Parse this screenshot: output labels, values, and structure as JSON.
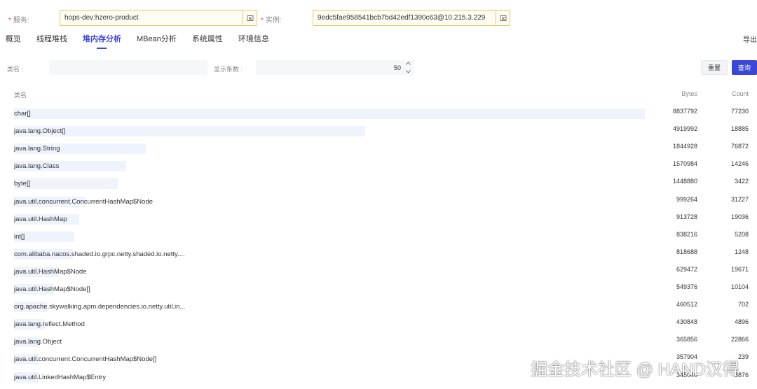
{
  "form": {
    "service_label": "服务",
    "service_value": "hops-dev:hzero-product",
    "instance_label": "实例",
    "instance_value": "9edc5fae958541bcb7bd42edf1390c63@10.215.3.229",
    "required_star": "*"
  },
  "tabs": [
    "概览",
    "线程堆栈",
    "堆内存分析",
    "MBean分析",
    "系统属性",
    "环境信息"
  ],
  "active_tab": "堆内存分析",
  "export_label": "导出",
  "filters": {
    "class_label": "类名 :",
    "class_value": "",
    "limit_label": "显示条数 :",
    "limit_value": "50",
    "reset_label": "重置",
    "query_label": "查询"
  },
  "table": {
    "columns": [
      "类名",
      "Bytes",
      "Count"
    ],
    "rows": [
      {
        "name": "char[]",
        "bytes": "8837792",
        "count": "77230",
        "ratio": 1.0
      },
      {
        "name": "java.lang.Object[]",
        "bytes": "4919992",
        "count": "18885",
        "ratio": 0.557
      },
      {
        "name": "java.lang.String",
        "bytes": "1844928",
        "count": "76872",
        "ratio": 0.209
      },
      {
        "name": "java.lang.Class",
        "bytes": "1570984",
        "count": "14246",
        "ratio": 0.178
      },
      {
        "name": "byte[]",
        "bytes": "1448880",
        "count": "3422",
        "ratio": 0.164
      },
      {
        "name": "java.util.concurrent.ConcurrentHashMap$Node",
        "bytes": "999264",
        "count": "31227",
        "ratio": 0.113
      },
      {
        "name": "java.util.HashMap",
        "bytes": "913728",
        "count": "19036",
        "ratio": 0.103
      },
      {
        "name": "int[]",
        "bytes": "838216",
        "count": "5208",
        "ratio": 0.095
      },
      {
        "name": "com.alibaba.nacos.shaded.io.grpc.netty.shaded.io.netty....",
        "bytes": "818688",
        "count": "1248",
        "ratio": 0.093
      },
      {
        "name": "java.util.HashMap$Node",
        "bytes": "629472",
        "count": "19671",
        "ratio": 0.071
      },
      {
        "name": "java.util.HashMap$Node[]",
        "bytes": "549376",
        "count": "10104",
        "ratio": 0.062
      },
      {
        "name": "org.apache.skywalking.apm.dependencies.io.netty.util.in...",
        "bytes": "460512",
        "count": "702",
        "ratio": 0.052
      },
      {
        "name": "java.lang.reflect.Method",
        "bytes": "430848",
        "count": "4896",
        "ratio": 0.049
      },
      {
        "name": "java.lang.Object",
        "bytes": "365856",
        "count": "22866",
        "ratio": 0.041
      },
      {
        "name": "java.util.concurrent.ConcurrentHashMap$Node[]",
        "bytes": "357904",
        "count": "239",
        "ratio": 0.04
      },
      {
        "name": "java.util.LinkedHashMap$Entry",
        "bytes": "345040",
        "count": "8876",
        "ratio": 0.039
      }
    ]
  },
  "watermark": "掘金技术社区 @ HAND汉得",
  "colors": {
    "accent": "#3b45d6",
    "required": "#e5484d",
    "select_border": "#e6c76a",
    "bar": "#eef3fc"
  }
}
